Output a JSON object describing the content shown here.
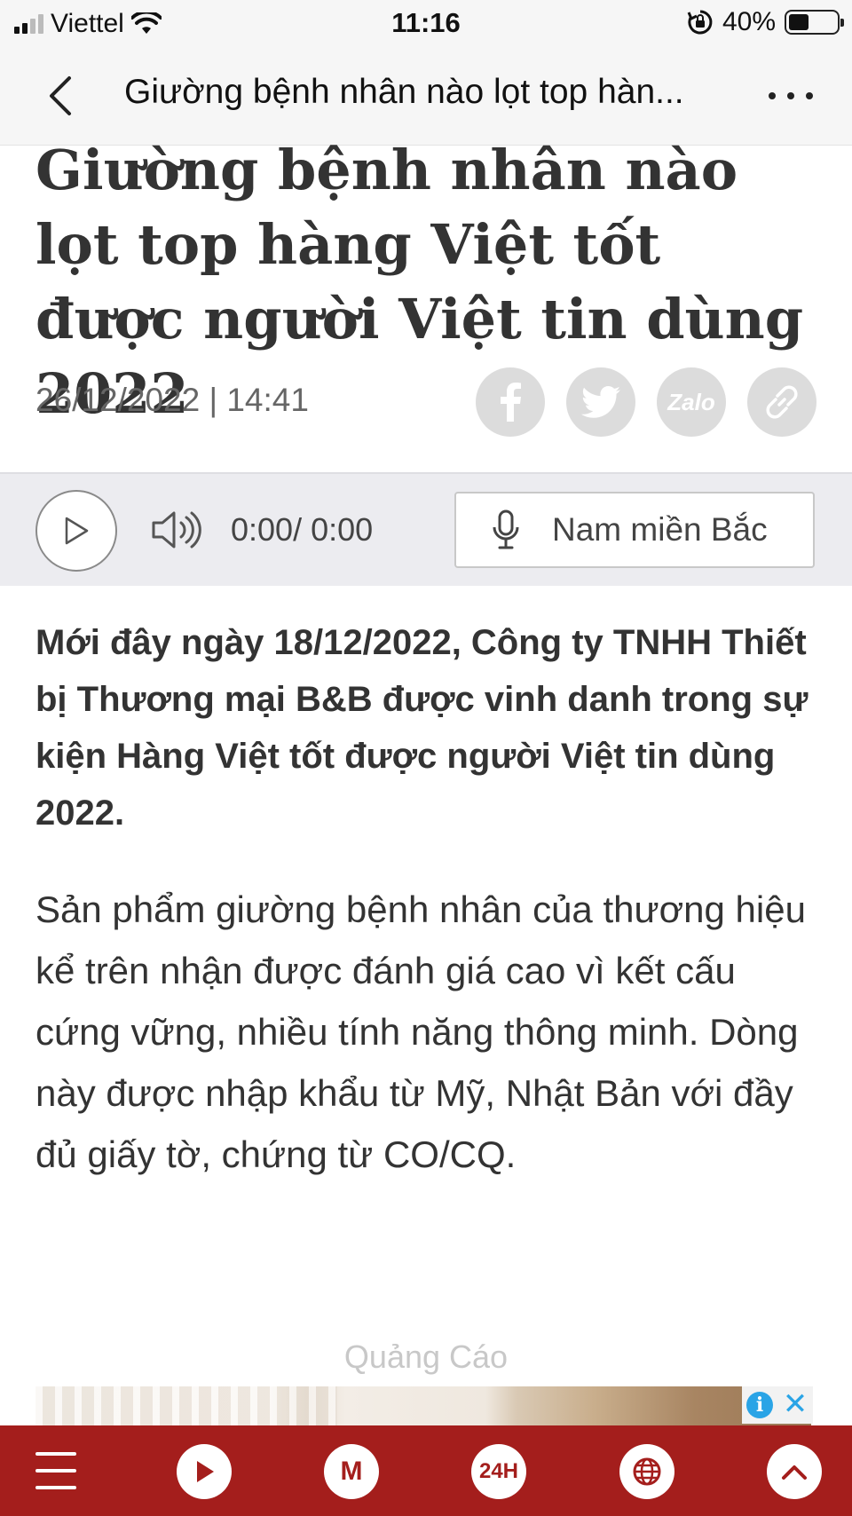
{
  "status_bar": {
    "carrier": "Viettel",
    "time": "11:16",
    "battery": "40%"
  },
  "nav": {
    "title": "Giường bệnh nhân nào lọt top hàn..."
  },
  "article": {
    "headline": "Giường bệnh nhân nào lọt top hàng Việt tốt được người Việt tin dùng 2022",
    "date": "26/12/2022 | 14:41",
    "share": [
      "facebook-icon",
      "twitter-icon",
      "zalo-icon",
      "link-icon"
    ],
    "share_zalo_text": "Zalo",
    "lead": "Mới đây ngày 18/12/2022, Công ty TNHH Thiết bị Thương mại B&B được vinh danh trong sự kiện Hàng Việt tốt được người Việt tin dùng 2022.",
    "paragraph": "Sản phẩm giường bệnh nhân của thương hiệu kể trên nhận được đánh giá cao vì kết cấu cứng vững, nhiều tính năng thông minh. Dòng này được nhập khẩu từ Mỹ, Nhật Bản với đầy đủ giấy tờ, chứng từ CO/CQ."
  },
  "audio": {
    "time": "0:00/ 0:00",
    "voice": "Nam miền Bắc"
  },
  "ad": {
    "label": "Quảng Cáo",
    "info": "i",
    "close": "✕"
  },
  "toolbar": {
    "m_label": "M",
    "h24_label": "24H"
  },
  "colors": {
    "brand_red": "#a41e1c",
    "ad_blue": "#2aa4e6"
  }
}
